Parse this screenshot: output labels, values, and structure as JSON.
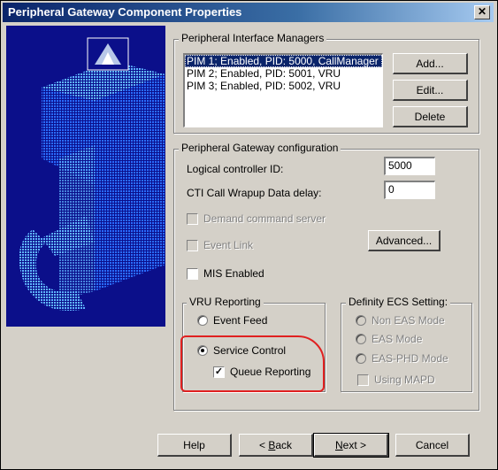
{
  "window": {
    "title": "Peripheral Gateway Component Properties",
    "close_glyph": "✕"
  },
  "pim": {
    "legend": "Peripheral Interface Managers",
    "items": [
      "PIM 1; Enabled, PID: 5000, CallManager",
      "PIM 2; Enabled, PID: 5001, VRU",
      "PIM 3; Enabled, PID: 5002, VRU"
    ],
    "selected_index": 0,
    "add_label": "Add...",
    "edit_label": "Edit...",
    "delete_label": "Delete"
  },
  "pg_config": {
    "legend": "Peripheral Gateway configuration",
    "logical_controller_label": "Logical controller ID:",
    "logical_controller_value": "5000",
    "cti_wrapup_label": "CTI Call Wrapup Data delay:",
    "cti_wrapup_value": "0",
    "demand_command_label": "Demand command server",
    "event_link_label": "Event Link",
    "advanced_label": "Advanced...",
    "mis_enabled_label": "MIS Enabled"
  },
  "vru_reporting": {
    "legend": "VRU Reporting",
    "event_feed_label": "Event Feed",
    "service_control_label": "Service Control",
    "queue_reporting_label": "Queue Reporting",
    "selected": "Service Control",
    "queue_reporting_checked": true
  },
  "definity": {
    "legend": "Definity ECS Setting:",
    "non_eas_label": "Non EAS Mode",
    "eas_label": "EAS Mode",
    "eas_phd_label": "EAS-PHD Mode",
    "using_mapd_label": "Using MAPD"
  },
  "footer": {
    "help_label": "Help",
    "back_prefix": "< ",
    "back_mnemonic": "B",
    "back_rest": "ack",
    "next_mnemonic": "N",
    "next_rest": "ext >",
    "cancel_label": "Cancel"
  },
  "colors": {
    "title_bar": "#0a246a",
    "dialog_face": "#d4d0c8",
    "wizard_panel": "#0b0f8a",
    "highlight_annotation": "#e02020"
  }
}
